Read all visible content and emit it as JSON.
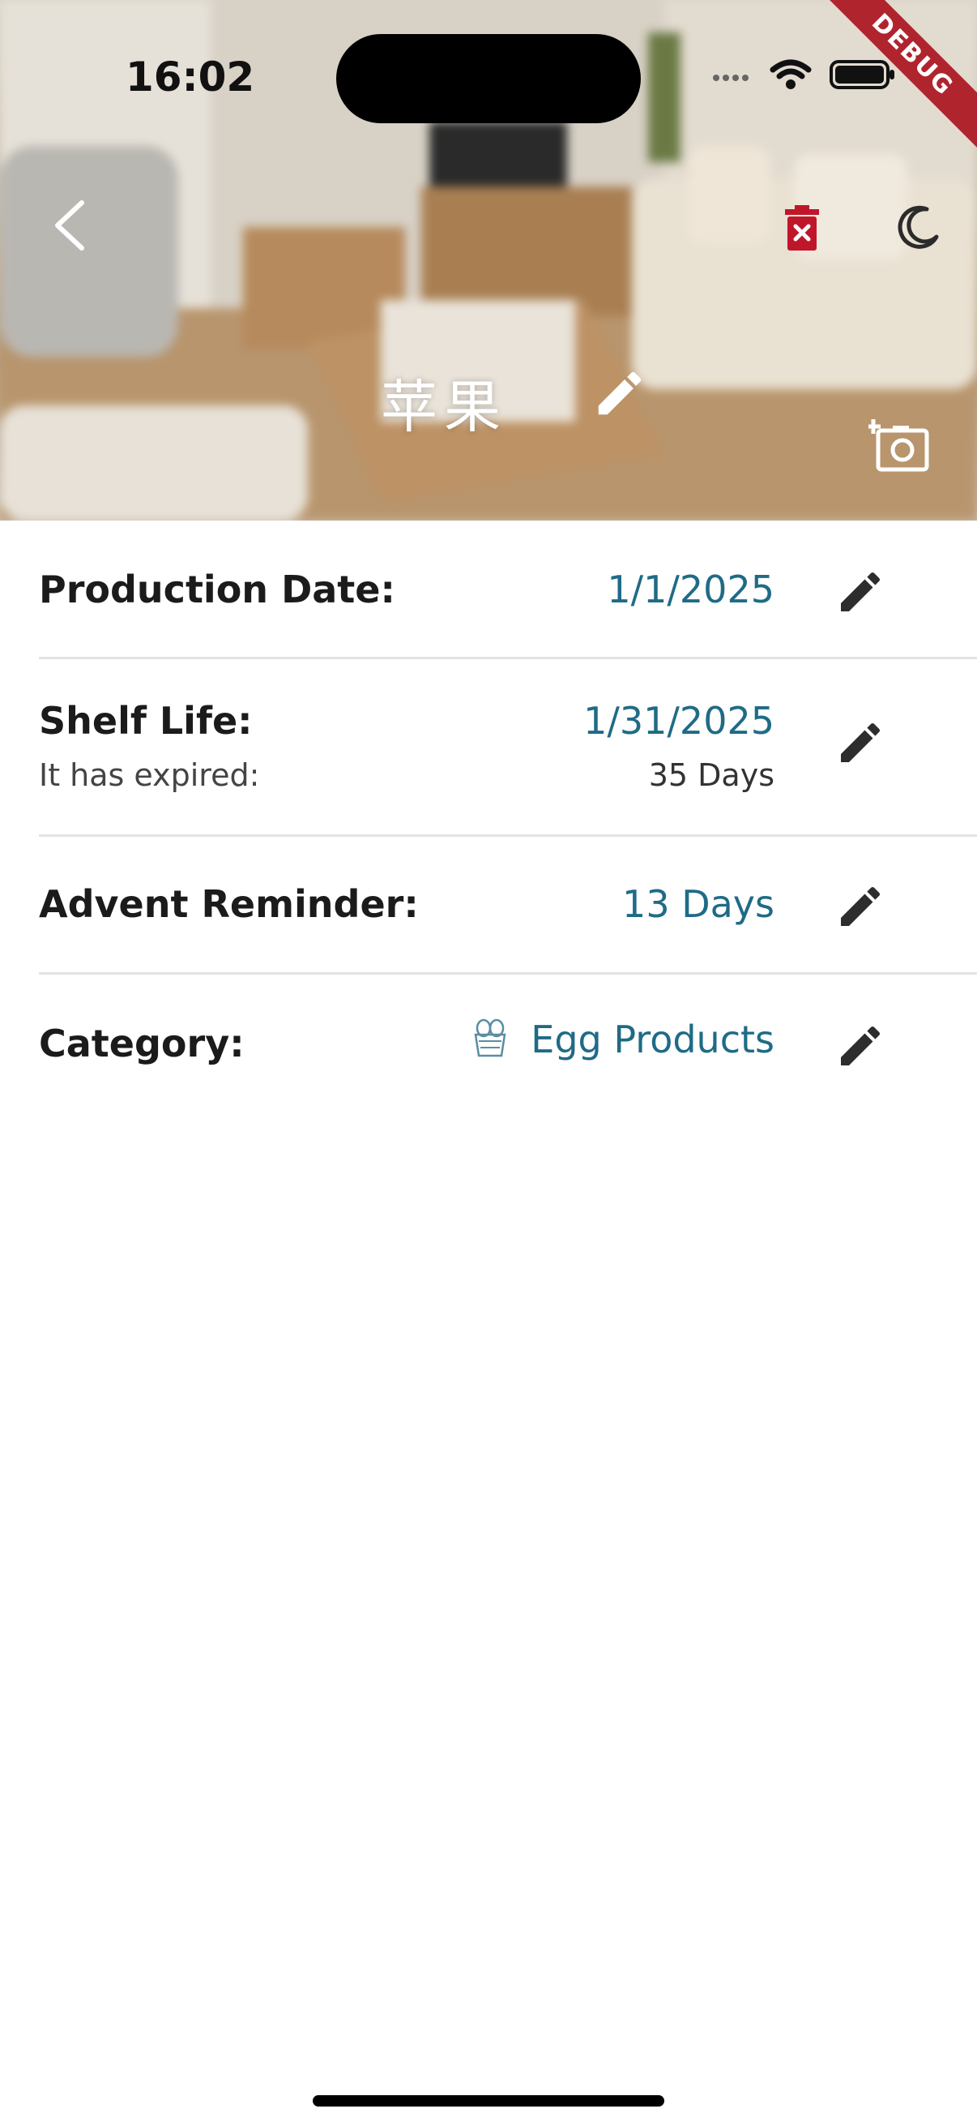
{
  "status_bar": {
    "time": "16:02",
    "debug_label": "DEBUG"
  },
  "header": {
    "title": "苹果",
    "back_icon": "chevron-left-icon",
    "delete_icon": "trash-x-icon",
    "theme_icon": "moon-icon",
    "edit_title_icon": "pencil-icon",
    "add_photo_icon": "camera-add-icon",
    "colors": {
      "delete": "#c0162a",
      "accent": "#1f6b86"
    }
  },
  "details": {
    "production_date": {
      "label": "Production Date:",
      "value": "1/1/2025"
    },
    "shelf_life": {
      "label": "Shelf Life:",
      "value": "1/31/2025",
      "sub_label": "It has expired:",
      "sub_value": "35 Days"
    },
    "advent_reminder": {
      "label": "Advent Reminder:",
      "value": "13 Days"
    },
    "category": {
      "label": "Category:",
      "value": "Egg Products",
      "icon": "egg-basket-icon"
    }
  }
}
